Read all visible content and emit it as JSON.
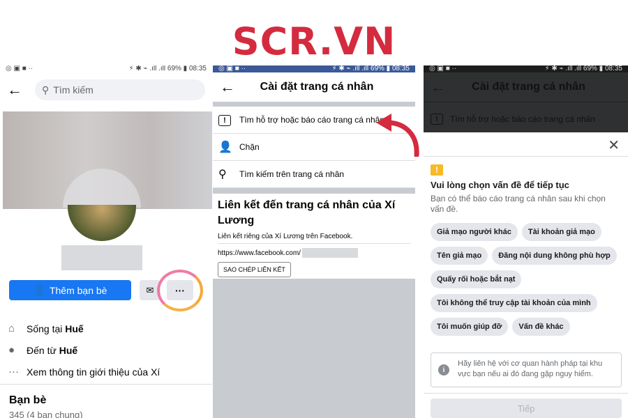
{
  "logo": "SCR.VN",
  "status_bar": {
    "left": "◎ ▣ ■  ··",
    "right": "⚡ ✱ ⌁ .ıll .ıll 69% ▮ 08:35",
    "battery": "69%",
    "time": "08:35"
  },
  "profile_screen": {
    "search_placeholder": "Tìm kiếm",
    "add_friend_label": "Thêm bạn bè",
    "more_label": "···",
    "info": [
      {
        "icon": "home-icon",
        "prefix": "Sống tại ",
        "value": "Huế"
      },
      {
        "icon": "location-pin-icon",
        "prefix": "Đến từ ",
        "value": "Huế"
      },
      {
        "icon": "more-dots-icon",
        "prefix": "Xem thông tin giới thiệu của Xí",
        "value": ""
      }
    ],
    "friends_title": "Bạn bè",
    "friends_sub": "345 (4 bạn chung)"
  },
  "settings_screen": {
    "title": "Cài đặt trang cá nhân",
    "menu": [
      {
        "icon": "report-icon",
        "label": "Tìm hỗ trợ hoặc báo cáo trang cá nhân"
      },
      {
        "icon": "block-user-icon",
        "label": "Chặn"
      },
      {
        "icon": "search-icon",
        "label": "Tìm kiếm trên trang cá nhân"
      }
    ],
    "link_title": "Liên kết đến trang cá nhân của Xí Lương",
    "link_desc": "Liên kết riêng của Xí Lương trên Facebook.",
    "link_url": "https://www.facebook.com/",
    "copy_label": "SAO CHÉP LIÊN KẾT",
    "arrow_color": "#d42b3f"
  },
  "report_screen": {
    "title": "Cài đặt trang cá nhân",
    "row_label": "Tìm hỗ trợ hoặc báo cáo trang cá nhân",
    "sheet_title": "Vui lòng chọn vấn đề để tiếp tục",
    "sheet_sub": "Bạn có thể báo cáo trang cá nhân sau khi chọn vấn đề.",
    "chips": [
      [
        "Giả mạo người khác",
        "Tài khoản giả mạo"
      ],
      [
        "Tên giả mạo",
        "Đăng nội dung không phù hợp"
      ],
      [
        "Quấy rối hoặc bắt nạt"
      ],
      [
        "Tôi không thể truy cập tài khoản của mình"
      ],
      [
        "Tôi muốn giúp đỡ",
        "Vấn đề khác"
      ]
    ],
    "help_text": "Hãy liên hệ với cơ quan hành pháp tại khu vực bạn nếu ai đó đang gặp nguy hiểm.",
    "next_label": "Tiếp"
  }
}
